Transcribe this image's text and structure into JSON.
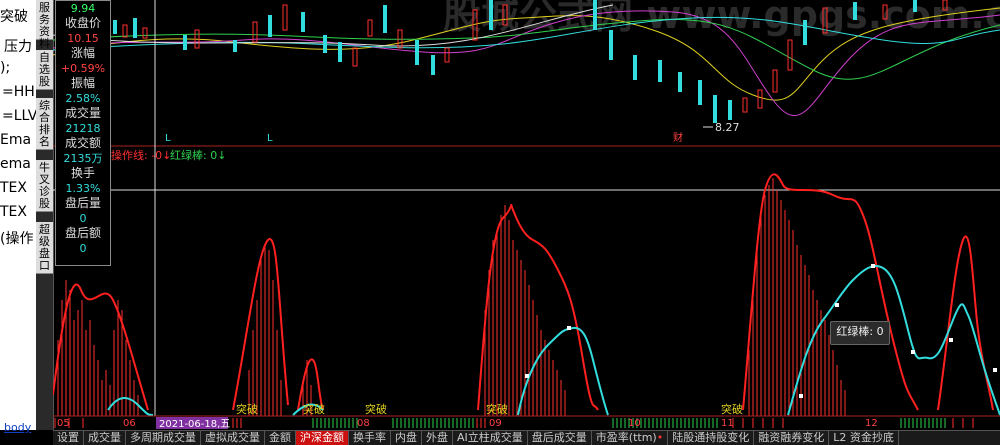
{
  "editor": {
    "lines": [
      "突破",
      "压力",
      ");",
      "=HH",
      "=LLV",
      "Ema",
      "ema",
      "TEX",
      "TEX",
      "(操作"
    ],
    "footer_link": "body"
  },
  "leftbar": {
    "items": [
      "服务资料",
      "自选股",
      "综合排名",
      "牛叉诊股",
      "超级盘口"
    ]
  },
  "data_window": {
    "top_value": "9.94",
    "labels": {
      "close": "收盘价",
      "change": "涨幅",
      "amplitude": "振幅",
      "volume": "成交量",
      "turnover_amt": "成交额",
      "turnover_rate": "换手",
      "after_vol": "盘后量",
      "after_amt": "盘后额"
    },
    "values": {
      "close": "10.15",
      "change": "+0.59%",
      "amplitude": "2.58%",
      "volume": "21218",
      "turnover_amt": "2135万",
      "turnover_rate": "1.33%",
      "after_vol": "0",
      "after_amt": "0"
    }
  },
  "chart": {
    "watermark": "股城公式网 www.gpgs.com.cn",
    "low_price_label": "8.27",
    "markers_L": [
      "L",
      "L"
    ],
    "marker_cai": "财",
    "indicator_label_1": "操作线: -0↓",
    "indicator_label_2": "红绿棒: 0↓",
    "breakout_labels": [
      "突破",
      "突破",
      "突破",
      "突破",
      "突破"
    ],
    "date_labels": [
      "05",
      "06",
      "08",
      "09",
      "10",
      "11",
      "12"
    ],
    "date_box": "2021-06-18,五",
    "tooltip": "红绿棒: 0",
    "colors": {
      "red": "#ff2020",
      "cyan": "#33dddd",
      "yellow": "#e0d020",
      "magenta": "#d040d0",
      "green": "#30d050"
    }
  },
  "tabs": [
    {
      "label": "设置",
      "active": false,
      "dot": false
    },
    {
      "label": "成交量",
      "active": false,
      "dot": false
    },
    {
      "label": "多周期成交量",
      "active": false,
      "dot": false
    },
    {
      "label": "虚拟成交量",
      "active": false,
      "dot": false
    },
    {
      "label": "金额",
      "active": false,
      "dot": false
    },
    {
      "label": "沪深金额",
      "active": true,
      "dot": false
    },
    {
      "label": "换手率",
      "active": false,
      "dot": false
    },
    {
      "label": "内盘",
      "active": false,
      "dot": false
    },
    {
      "label": "外盘",
      "active": false,
      "dot": false
    },
    {
      "label": "AI立柱成交量",
      "active": false,
      "dot": false
    },
    {
      "label": "盘后成交量",
      "active": false,
      "dot": false
    },
    {
      "label": "市盈率(ttm)",
      "active": false,
      "dot": true
    },
    {
      "label": "陆股通持股变化",
      "active": false,
      "dot": false
    },
    {
      "label": "融资融券变化",
      "active": false,
      "dot": false
    },
    {
      "label": "L2 资金抄底",
      "active": false,
      "dot": false
    }
  ]
}
